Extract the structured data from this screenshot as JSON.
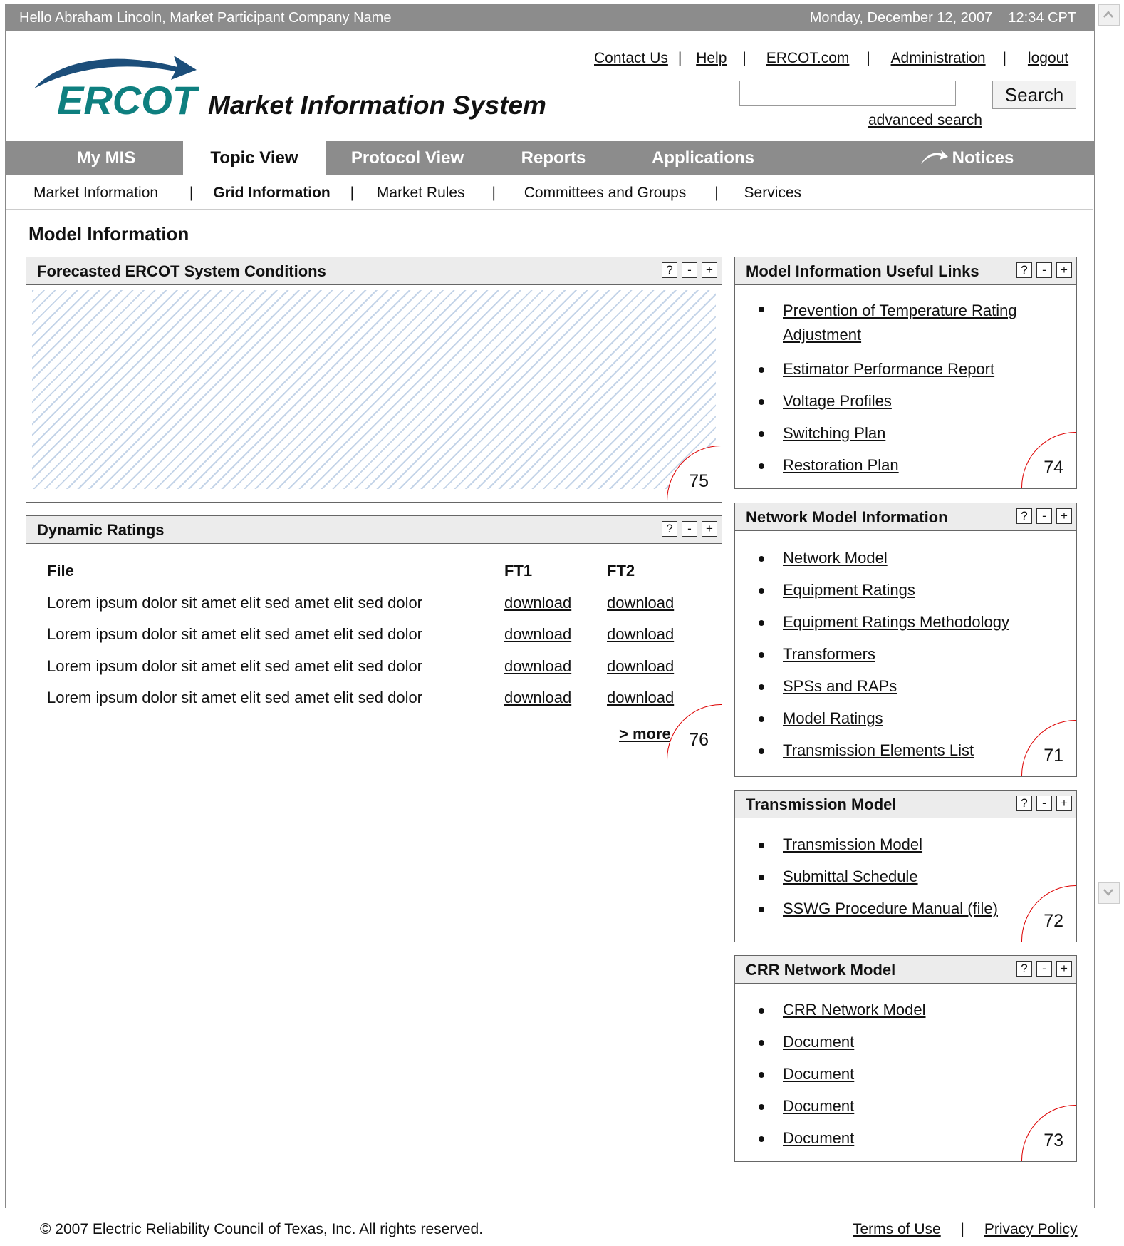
{
  "topbar": {
    "greeting": "Hello Abraham Lincoln, Market Participant Company Name",
    "datetime": "Monday, December 12, 2007    12:34 CPT"
  },
  "header": {
    "logo_text": "ERCOT",
    "app_title": "Market Information System",
    "util_links": [
      "Contact Us",
      "Help",
      "ERCOT.com",
      "Administration",
      "logout"
    ],
    "search": {
      "value": "",
      "button": "Search",
      "advanced": "advanced search"
    }
  },
  "nav": {
    "tabs": [
      "My MIS",
      "Topic View",
      "Protocol View",
      "Reports",
      "Applications",
      "Notices"
    ],
    "active_tab": "Topic View",
    "subnav": [
      "Market Information",
      "Grid Information",
      "Market Rules",
      "Committees and Groups",
      "Services"
    ],
    "active_subnav": "Grid Information"
  },
  "page_title": "Model Information",
  "controls": {
    "help": "?",
    "minimize": "-",
    "maximize": "+"
  },
  "panels": {
    "forecast": {
      "title": "Forecasted ERCOT System Conditions",
      "badge": "75"
    },
    "dynamic": {
      "title": "Dynamic Ratings",
      "headers": [
        "File",
        "FT1",
        "FT2"
      ],
      "rows": [
        [
          "Lorem ipsum dolor sit amet elit sed amet elit sed dolor",
          "download",
          "download"
        ],
        [
          "Lorem ipsum dolor sit amet elit sed amet elit sed dolor",
          "download",
          "download"
        ],
        [
          "Lorem ipsum dolor sit amet elit sed amet elit sed dolor",
          "download",
          "download"
        ],
        [
          "Lorem ipsum dolor sit amet elit sed amet elit sed dolor",
          "download",
          "download"
        ]
      ],
      "more": "> more",
      "badge": "76"
    },
    "useful_links": {
      "title": "Model Information Useful Links",
      "items": [
        "Prevention of Temperature Rating Adjustment",
        "Estimator Performance Report",
        "Voltage Profiles",
        "Switching Plan",
        "Restoration Plan"
      ],
      "badge": "74"
    },
    "network_model": {
      "title": "Network Model Information",
      "items": [
        "Network Model",
        "Equipment Ratings",
        "Equipment Ratings Methodology",
        "Transformers",
        "SPSs and RAPs",
        "Model Ratings",
        "Transmission Elements List"
      ],
      "badge": "71"
    },
    "transmission_model": {
      "title": "Transmission Model",
      "items": [
        "Transmission Model",
        "Submittal Schedule",
        "SSWG Procedure Manual (file)"
      ],
      "badge": "72"
    },
    "crr_model": {
      "title": "CRR Network Model",
      "items": [
        "CRR Network Model",
        "Document",
        "Document",
        "Document",
        "Document"
      ],
      "badge": "73"
    }
  },
  "footer": {
    "copyright": "© 2007 Electric Reliability Council of Texas, Inc.  All rights reserved.",
    "links": [
      "Terms of Use",
      "Privacy Policy"
    ]
  }
}
